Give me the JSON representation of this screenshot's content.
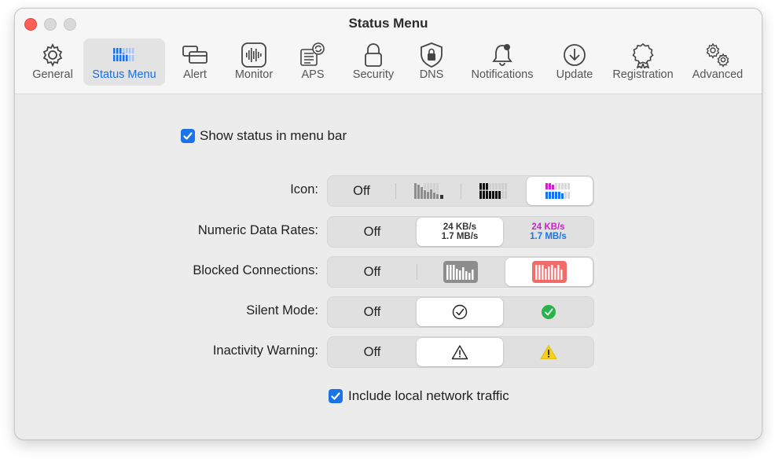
{
  "window": {
    "title": "Status Menu"
  },
  "toolbar": {
    "tabs": [
      {
        "label": "General",
        "icon": "gear-icon"
      },
      {
        "label": "Status Menu",
        "icon": "status-bars-icon",
        "active": true
      },
      {
        "label": "Alert",
        "icon": "alert-windows-icon"
      },
      {
        "label": "Monitor",
        "icon": "monitor-waveform-icon"
      },
      {
        "label": "APS",
        "icon": "aps-list-icon"
      },
      {
        "label": "Security",
        "icon": "lock-icon"
      },
      {
        "label": "DNS",
        "icon": "shield-lock-icon"
      },
      {
        "label": "Notifications",
        "icon": "bell-icon"
      },
      {
        "label": "Update",
        "icon": "download-circle-icon"
      },
      {
        "label": "Registration",
        "icon": "rosette-icon"
      },
      {
        "label": "Advanced",
        "icon": "gears-icon"
      }
    ]
  },
  "settings": {
    "show_status": {
      "label": "Show status in menu bar",
      "checked": true
    },
    "icon": {
      "label": "Icon:",
      "off": "Off",
      "selected_index": 3
    },
    "numeric_rates": {
      "label": "Numeric Data Rates:",
      "off": "Off",
      "selected_index": 1,
      "rate_up": "24 KB/s",
      "rate_down": "1.7 MB/s"
    },
    "blocked": {
      "label": "Blocked Connections:",
      "off": "Off",
      "selected_index": 2
    },
    "silent": {
      "label": "Silent Mode:",
      "off": "Off",
      "selected_index": 1
    },
    "inactivity": {
      "label": "Inactivity Warning:",
      "off": "Off",
      "selected_index": 1
    },
    "local_traffic": {
      "label": "Include local network traffic",
      "checked": true
    }
  },
  "colors": {
    "accent": "#1a73e8",
    "magenta": "#cc22cc",
    "blue": "#1a73e8",
    "blocked_red": "#f26b6b",
    "green": "#2ab34a",
    "warning_yellow": "#f7d117"
  }
}
